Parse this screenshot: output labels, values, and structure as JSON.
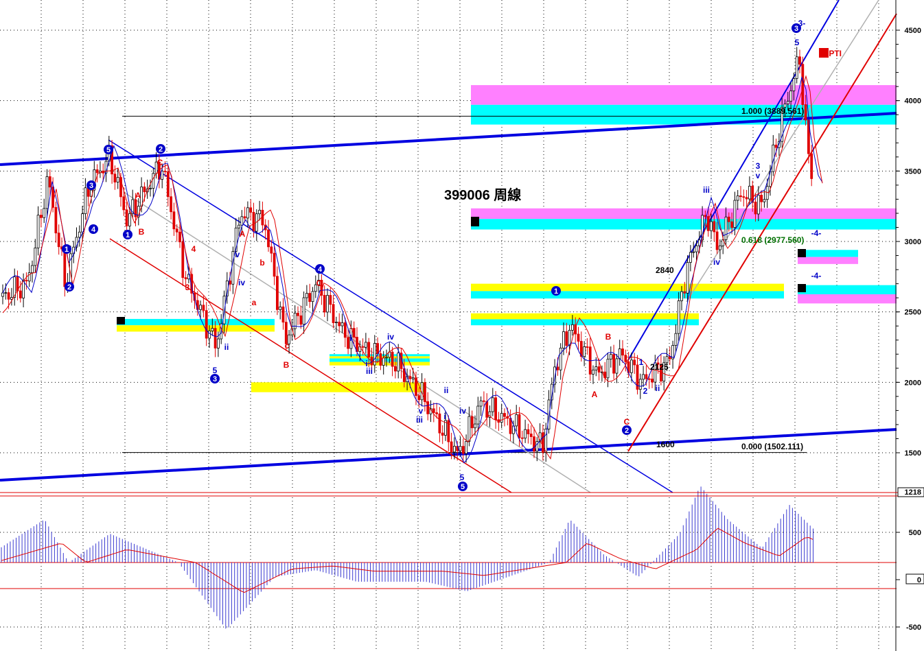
{
  "chart_data": {
    "type": "candlestick",
    "title": "399006 周線",
    "period": "weekly",
    "price_axis": {
      "ticks": [
        1500,
        2000,
        2500,
        3000,
        3500,
        4000,
        4500
      ],
      "tick_labels": [
        "1500",
        "2000",
        "2500",
        "3000",
        "3500",
        "4000",
        "4500"
      ],
      "range": [
        1218,
        4680
      ],
      "current_low_label": "1218",
      "scale": "linear"
    },
    "oscillator_axis": {
      "ticks": [
        500,
        0,
        -500
      ],
      "tick_labels": [
        "500",
        "0",
        "-500"
      ],
      "range": [
        -700,
        800
      ]
    },
    "grid": true,
    "fib_levels": [
      {
        "label": "1.000 (3889.561)",
        "value": 3889.561
      },
      {
        "label": "0.618 (2977.560)",
        "value": 2977.56
      },
      {
        "label": "0.000 (1502.111)",
        "value": 1502.111
      }
    ],
    "price_annotations": [
      {
        "text": "2840",
        "value": 2840
      },
      {
        "text": "2125",
        "value": 2125
      },
      {
        "text": "1600",
        "value": 1600
      }
    ],
    "pti_label": "42PTI",
    "zones": [
      {
        "colors": [
          "#ff80ff",
          "#00ffff"
        ],
        "from": 3830,
        "to": 4110
      },
      {
        "colors": [
          "#ff80ff",
          "#00ffff"
        ],
        "from": 3085,
        "to": 3235
      },
      {
        "colors": [
          "#00ffff",
          "#ff80ff"
        ],
        "from": 2840,
        "to": 2940
      },
      {
        "colors": [
          "#00ffff",
          "#ff80ff"
        ],
        "from": 2560,
        "to": 2690
      },
      {
        "colors": [
          "#ffff00",
          "#00ffff"
        ],
        "from": 2595,
        "to": 2700
      },
      {
        "colors": [
          "#ffff00",
          "#00ffff"
        ],
        "from": 2405,
        "to": 2490
      },
      {
        "colors": [
          "#00ffff",
          "#ffff00"
        ],
        "from": 2360,
        "to": 2450
      },
      {
        "colors": [
          "#00ffff",
          "#ffff00"
        ],
        "from": 2120,
        "to": 2170
      },
      {
        "colors": [
          "#00ffff",
          "#ffff00"
        ],
        "from": 2170,
        "to": 2200
      },
      {
        "colors": [
          "#ffff00"
        ],
        "from": 1930,
        "to": 2000
      }
    ],
    "wave_labels": [
      {
        "text": "5",
        "style": "circle"
      },
      {
        "text": "2",
        "style": "circle"
      },
      {
        "text": "3",
        "style": "circle"
      },
      {
        "text": "4",
        "style": "circle"
      },
      {
        "text": "1",
        "style": "circle"
      },
      {
        "text": "2",
        "style": "circle"
      },
      {
        "text": "1",
        "style": "circle"
      },
      {
        "text": "3",
        "style": "circle"
      },
      {
        "text": "4",
        "style": "circle"
      },
      {
        "text": "5",
        "style": "circle"
      },
      {
        "text": "1",
        "style": "circle"
      },
      {
        "text": "2",
        "style": "circle"
      },
      {
        "text": "3",
        "style": "circle"
      },
      {
        "text": "A"
      },
      {
        "text": "B"
      },
      {
        "text": "C"
      },
      {
        "text": "A"
      },
      {
        "text": "b"
      },
      {
        "text": "a"
      },
      {
        "text": "c"
      },
      {
        "text": "B"
      },
      {
        "text": "C"
      },
      {
        "text": "iii"
      },
      {
        "text": "iv"
      },
      {
        "text": "ii"
      },
      {
        "text": "4"
      },
      {
        "text": "3"
      },
      {
        "text": "5"
      },
      {
        "text": "v"
      },
      {
        "text": "i"
      },
      {
        "text": "iv"
      },
      {
        "text": "iii"
      },
      {
        "text": "v"
      },
      {
        "text": "3"
      },
      {
        "text": "ii"
      },
      {
        "text": "iv"
      },
      {
        "text": "i"
      },
      {
        "text": "5"
      },
      {
        "text": "1"
      },
      {
        "text": "2"
      },
      {
        "text": "A"
      },
      {
        "text": "B"
      },
      {
        "text": "C"
      },
      {
        "text": "ii"
      },
      {
        "text": "i"
      },
      {
        "text": "iii"
      },
      {
        "text": "iv"
      },
      {
        "text": "v"
      },
      {
        "text": "-4-"
      },
      {
        "text": "-4-"
      },
      {
        "text": "3-"
      },
      {
        "text": "5"
      }
    ]
  }
}
